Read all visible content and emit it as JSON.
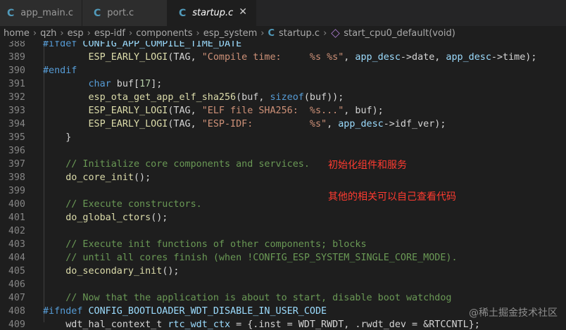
{
  "tabs": [
    {
      "icon": "C",
      "label": "app_main.c"
    },
    {
      "icon": "C",
      "label": "port.c"
    },
    {
      "icon": "C",
      "label": "startup.c",
      "close": "✕"
    }
  ],
  "breadcrumb": {
    "parts": [
      "home",
      "qzh",
      "esp",
      "esp-idf",
      "components",
      "esp_system"
    ],
    "file_icon": "C",
    "file": "startup.c",
    "symbol": "start_cpu0_default(void)",
    "sep": "›"
  },
  "lines": [
    {
      "n": "388",
      "t": "#ifdef CONFIG_APP_COMPILE_TIME_DATE"
    },
    {
      "n": "389",
      "t": "        ESP_EARLY_LOGI(TAG, \"Compile time:     %s %s\", app_desc->date, app_desc->time);"
    },
    {
      "n": "390",
      "t": "#endif"
    },
    {
      "n": "391",
      "t": "        char buf[17];"
    },
    {
      "n": "392",
      "t": "        esp_ota_get_app_elf_sha256(buf, sizeof(buf));"
    },
    {
      "n": "393",
      "t": "        ESP_EARLY_LOGI(TAG, \"ELF file SHA256:  %s...\", buf);"
    },
    {
      "n": "394",
      "t": "        ESP_EARLY_LOGI(TAG, \"ESP-IDF:          %s\", app_desc->idf_ver);"
    },
    {
      "n": "395",
      "t": "    }"
    },
    {
      "n": "396",
      "t": ""
    },
    {
      "n": "397",
      "t": "    // Initialize core components and services."
    },
    {
      "n": "398",
      "t": "    do_core_init();"
    },
    {
      "n": "399",
      "t": ""
    },
    {
      "n": "400",
      "t": "    // Execute constructors."
    },
    {
      "n": "401",
      "t": "    do_global_ctors();"
    },
    {
      "n": "402",
      "t": ""
    },
    {
      "n": "403",
      "t": "    // Execute init functions of other components; blocks"
    },
    {
      "n": "404",
      "t": "    // until all cores finish (when !CONFIG_ESP_SYSTEM_SINGLE_CORE_MODE)."
    },
    {
      "n": "405",
      "t": "    do_secondary_init();"
    },
    {
      "n": "406",
      "t": ""
    },
    {
      "n": "407",
      "t": "    // Now that the application is about to start, disable boot watchdog"
    },
    {
      "n": "408",
      "t": "#ifndef CONFIG_BOOTLOADER_WDT_DISABLE_IN_USER_CODE"
    },
    {
      "n": "409",
      "t": "    wdt_hal_context_t rtc_wdt_ctx = {.inst = WDT_RWDT, .rwdt_dev = &RTCCNTL};"
    }
  ],
  "annotations": {
    "a1": "初始化组件和服务",
    "a2": "其他的相关可以自己查看代码"
  },
  "watermark": "@稀土掘金技术社区",
  "colors": {
    "keyword": "#569cd6",
    "comment": "#6a9955",
    "string": "#ce9178",
    "function": "#dcdcaa",
    "annotation": "#ff3b30",
    "c_icon": "#519aba"
  }
}
